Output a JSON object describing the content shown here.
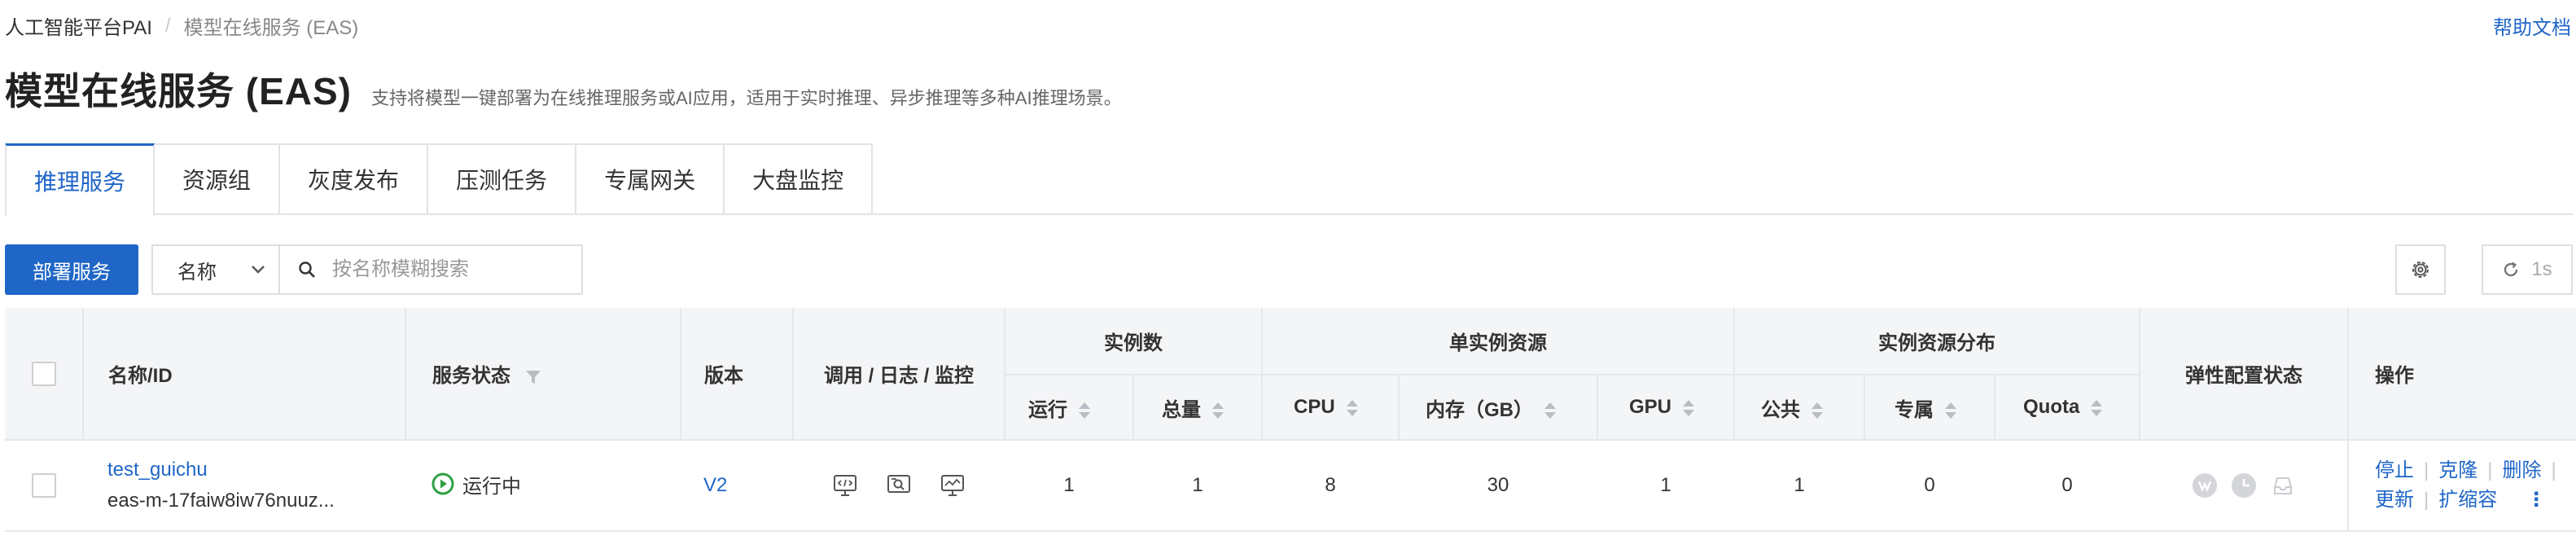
{
  "breadcrumb": {
    "root": "人工智能平台PAI",
    "separator": "/",
    "current": "模型在线服务 (EAS)"
  },
  "help_link": "帮助文档",
  "page": {
    "title": "模型在线服务 (EAS)",
    "description": "支持将模型一键部署为在线推理服务或AI应用，适用于实时推理、异步推理等多种AI推理场景。"
  },
  "tabs": [
    "推理服务",
    "资源组",
    "灰度发布",
    "压测任务",
    "专属网关",
    "大盘监控"
  ],
  "active_tab": "推理服务",
  "toolbar": {
    "deploy_label": "部署服务",
    "search_field": "名称",
    "search_placeholder": "按名称模糊搜索",
    "refresh_label": "1s"
  },
  "table": {
    "headers": {
      "name_id": "名称/ID",
      "status": "服务状态",
      "version": "版本",
      "invoke": "调用 / 日志 / 监控",
      "instances_group": "实例数",
      "running": "运行",
      "total": "总量",
      "single_resource_group": "单实例资源",
      "cpu": "CPU",
      "memory": "内存（GB）",
      "gpu": "GPU",
      "distribution_group": "实例资源分布",
      "public": "公共",
      "dedicated": "专属",
      "quota": "Quota",
      "elastic": "弹性配置状态",
      "actions": "操作"
    },
    "rows": [
      {
        "name": "test_guichu",
        "id": "eas-m-17faiw8iw76nuuz...",
        "status": "运行中",
        "version": "V2",
        "running": "1",
        "total": "1",
        "cpu": "8",
        "memory": "30",
        "gpu": "1",
        "public": "1",
        "dedicated": "0",
        "quota": "0",
        "actions": {
          "stop": "停止",
          "clone": "克隆",
          "delete": "删除",
          "update": "更新",
          "scale": "扩缩容"
        }
      }
    ]
  },
  "colors": {
    "accent": "#1f66c7",
    "status_running": "#2fa043",
    "header_bg": "#f4f5f7"
  },
  "icons": [
    "gear-icon",
    "refresh-icon",
    "search-icon",
    "filter-icon",
    "sort-icon",
    "running-status-icon",
    "invoke-icon",
    "log-icon",
    "monitor-icon",
    "more-icon",
    "elastic-scale-icon",
    "schedule-icon",
    "inbox-icon"
  ]
}
